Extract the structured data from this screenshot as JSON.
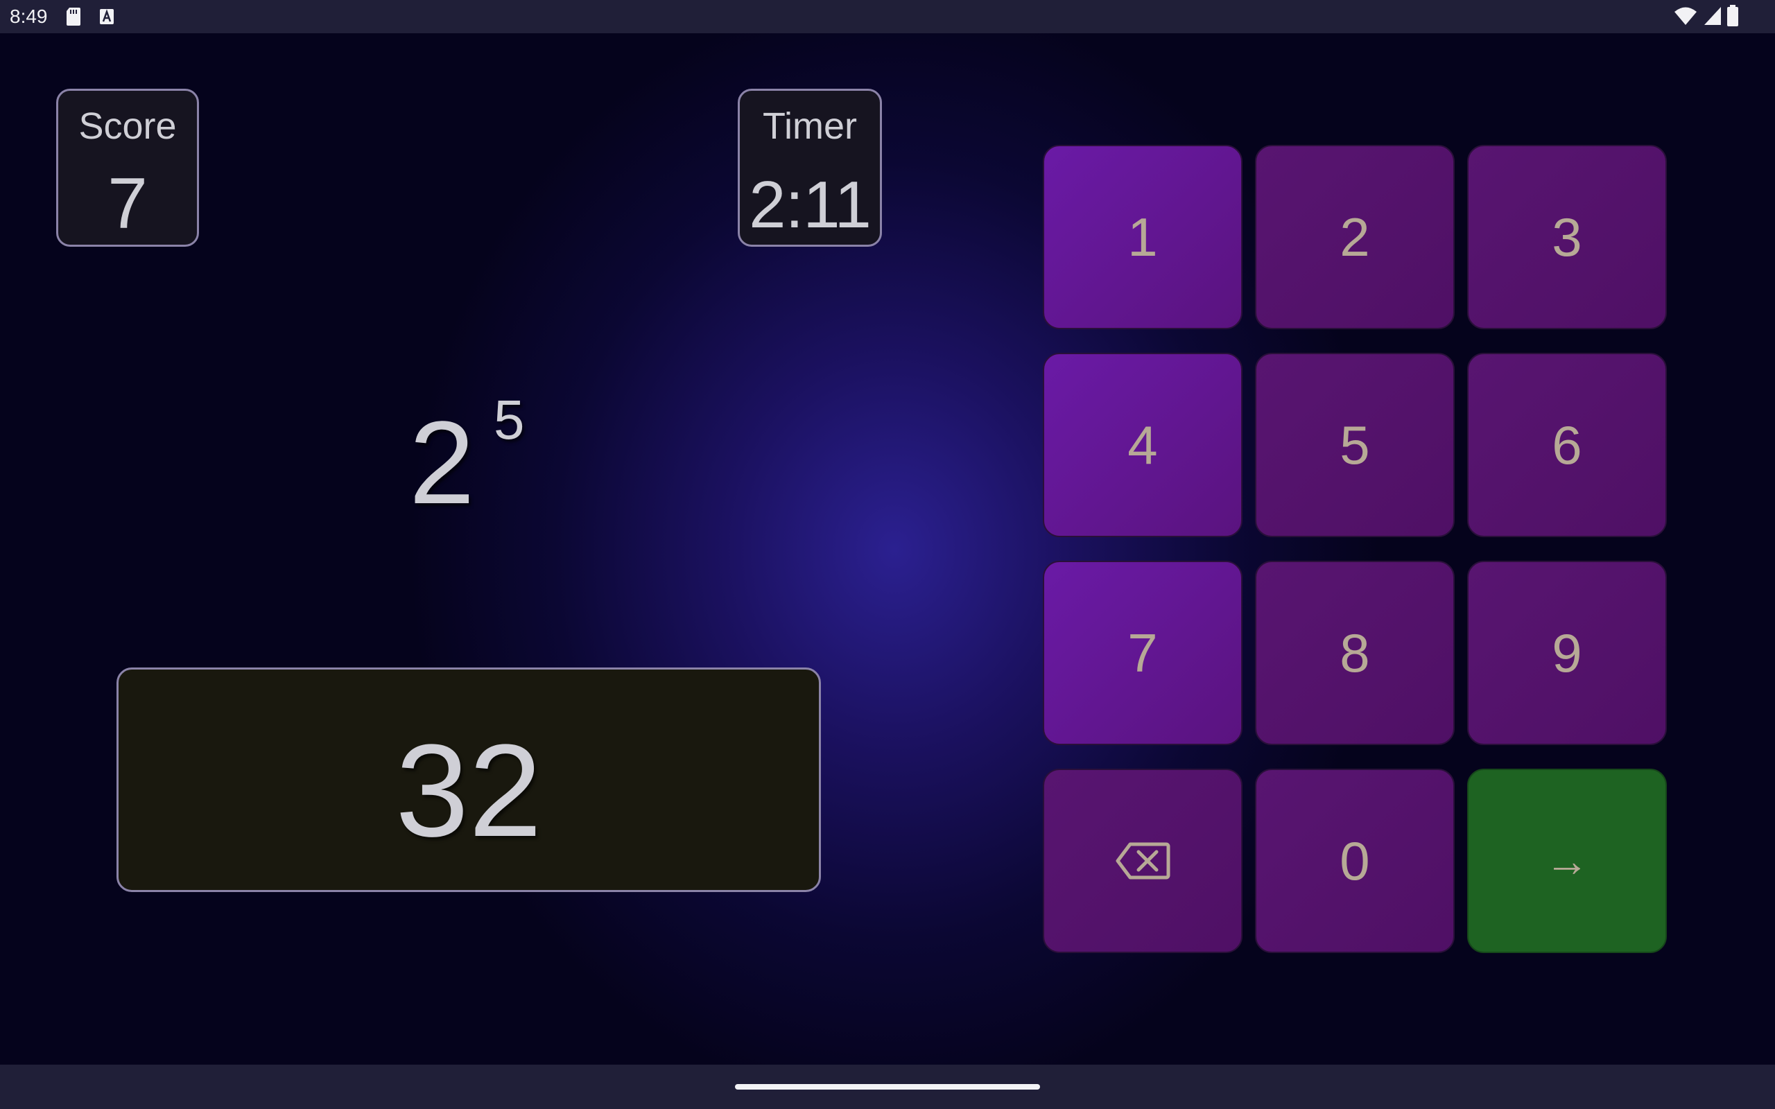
{
  "status_bar": {
    "time": "8:49"
  },
  "score": {
    "label": "Score",
    "value": "7"
  },
  "timer": {
    "label": "Timer",
    "value": "2:11"
  },
  "question": {
    "base": "2",
    "exponent": "5"
  },
  "answer": {
    "value": "32"
  },
  "keypad": {
    "keys": [
      {
        "label": "1"
      },
      {
        "label": "2"
      },
      {
        "label": "3"
      },
      {
        "label": "4"
      },
      {
        "label": "5"
      },
      {
        "label": "6"
      },
      {
        "label": "7"
      },
      {
        "label": "8"
      },
      {
        "label": "9"
      },
      {
        "label": "",
        "icon": "backspace-icon"
      },
      {
        "label": "0"
      },
      {
        "label": "→"
      }
    ]
  },
  "colors": {
    "key_purple": "#6a1aa6",
    "key_submit": "#1e6322",
    "answer_bg": "#19180e",
    "text": "#cfcfd6"
  }
}
